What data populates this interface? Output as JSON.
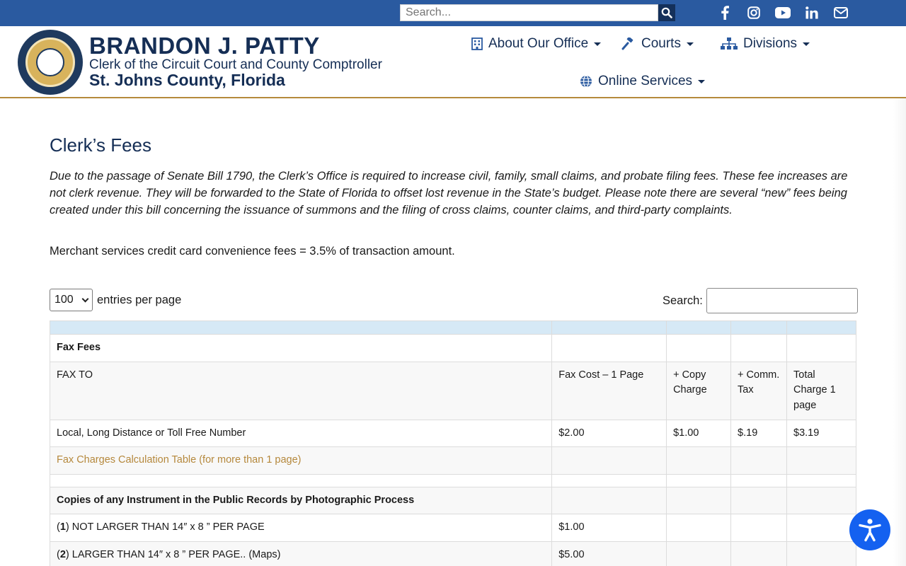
{
  "topbar": {
    "search_placeholder": "Search...",
    "social": [
      "facebook-icon",
      "instagram-icon",
      "youtube-icon",
      "linkedin-icon",
      "email-icon"
    ]
  },
  "header": {
    "name": "BRANDON J. PATTY",
    "subtitle": "Clerk of the Circuit Court and County Comptroller",
    "county": "St. Johns County, Florida"
  },
  "nav": {
    "about": "About Our Office",
    "courts": "Courts",
    "divisions": "Divisions",
    "online": "Online Services"
  },
  "page": {
    "title": "Clerk’s Fees",
    "intro": "Due to the passage of Senate Bill 1790, the Clerk’s Office is required to increase civil, family, small claims, and probate filing fees. These fee increases are not clerk revenue. They will be forwarded to the State of Florida to offset lost revenue in the State’s budget. Please note there are several “new” fees being created under this bill concerning the issuance of summons and the filing of cross claims, counter claims, and third-party complaints.",
    "merchant": "Merchant services credit card convenience fees = 3.5% of transaction amount."
  },
  "table_controls": {
    "entries_value": "100",
    "entries_label": "entries per page",
    "search_label": "Search:"
  },
  "table": {
    "fax_section": "Fax Fees",
    "fax_header": [
      "FAX TO",
      "Fax Cost – 1 Page",
      "+ Copy Charge",
      "+ Comm. Tax",
      "Total Charge 1 page"
    ],
    "fax_row": [
      "Local, Long Distance or Toll Free Number",
      "$2.00",
      "$1.00",
      "$.19",
      "$3.19"
    ],
    "fax_link": "Fax Charges Calculation Table (for more than 1 page)",
    "copies_section": "Copies of any Instrument in the Public Records by Photographic Process",
    "copy_row_1_num": "1",
    "copy_row_1_text": " NOT LARGER THAN 14″ x 8 ” PER PAGE",
    "copy_row_1_fee": "$1.00",
    "copy_row_2_num": "2",
    "copy_row_2_text": " LARGER THAN 14″ x 8 ” PER PAGE.. (Maps)",
    "copy_row_2_fee": "$5.00"
  },
  "colors": {
    "topbar": "#2a5aa0",
    "navy": "#152e55",
    "gold": "#b58a3c",
    "table_head": "#d6e9f6",
    "a11y": "#1461f0"
  }
}
